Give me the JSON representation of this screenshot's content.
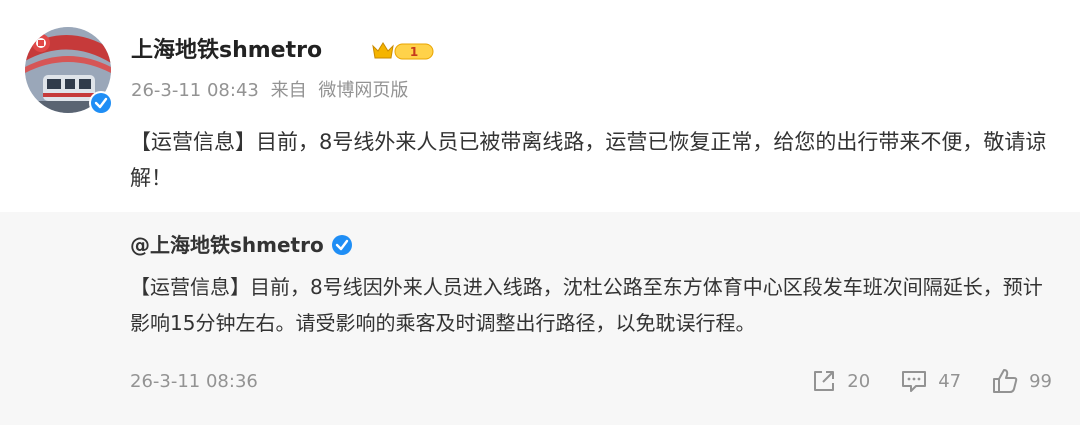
{
  "header": {
    "username": "上海地铁shmetro",
    "timestamp": "26-3-11 08:43",
    "source_prefix": "来自",
    "source": "微博网页版",
    "badge_level": "1"
  },
  "post": {
    "text": "【运营信息】目前，8号线外来人员已被带离线路，运营已恢复正常，给您的出行带来不便，敬请谅解！"
  },
  "quote": {
    "author": "@上海地铁shmetro",
    "text": "【运营信息】目前，8号线因外来人员进入线路，沈杜公路至东方体育中心区段发车班次间隔延长，预计影响15分钟左右。请受影响的乘客及时调整出行路径，以免耽误行程。",
    "timestamp": "26-3-11 08:36",
    "reposts": "20",
    "comments": "47",
    "likes": "99"
  },
  "colors": {
    "verified_blue": "#1f8ef5",
    "badge_gold": "#f5b400",
    "meta_gray": "#939393",
    "quote_bg": "#f7f7f7"
  },
  "icons": [
    "verified-icon",
    "member-crown-icon",
    "repost-icon",
    "comment-icon",
    "like-icon"
  ]
}
